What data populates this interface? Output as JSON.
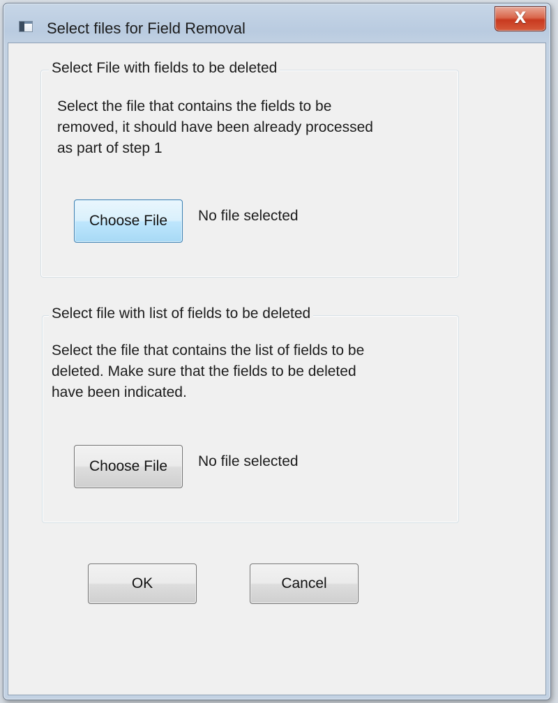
{
  "window": {
    "title": "Select files for Field Removal",
    "close_glyph": "X"
  },
  "group1": {
    "legend": "Select File with fields to be deleted",
    "description_lines": [
      "Select the file that contains the fields to be",
      "removed, it should have been already processed",
      "as part of step 1"
    ],
    "choose_label": "Choose File",
    "status": "No file selected"
  },
  "group2": {
    "legend": "Select file with list of fields to be deleted",
    "description_lines": [
      "Select the file that contains the list of fields to be",
      "deleted.  Make sure that the fields to be deleted",
      "have been indicated."
    ],
    "choose_label": "Choose File",
    "status": "No file selected"
  },
  "buttons": {
    "ok": "OK",
    "cancel": "Cancel"
  },
  "icons": {
    "app": "window-app-icon",
    "close": "close-icon"
  },
  "colors": {
    "dialog_bg": "#f0f0f0",
    "close_button": "#c8391f",
    "focused_button": "#bee6fd"
  }
}
